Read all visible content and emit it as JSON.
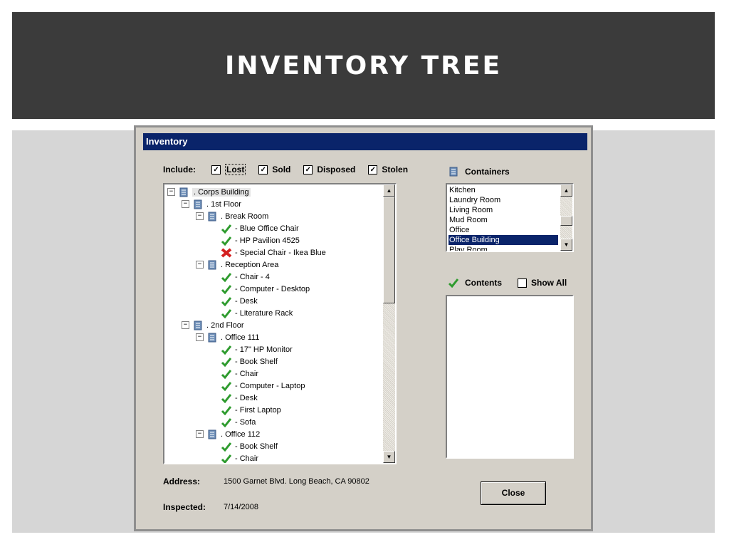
{
  "slide": {
    "title": "INVENTORY TREE"
  },
  "dialog": {
    "title": "Inventory",
    "include": {
      "label": "Include:",
      "options": [
        {
          "label": "Lost",
          "checked": true
        },
        {
          "label": "Sold",
          "checked": true
        },
        {
          "label": "Disposed",
          "checked": true
        },
        {
          "label": "Stolen",
          "checked": true
        }
      ]
    },
    "tree": {
      "nodes": [
        {
          "label": ". Corps Building",
          "level": 0,
          "type": "container",
          "expanded": true,
          "selected": true
        },
        {
          "label": ". 1st Floor",
          "level": 1,
          "type": "container",
          "expanded": true
        },
        {
          "label": ". Break Room",
          "level": 2,
          "type": "container",
          "expanded": true
        },
        {
          "label": "- Blue Office Chair",
          "level": 3,
          "type": "ok"
        },
        {
          "label": "- HP Pavilion 4525",
          "level": 3,
          "type": "ok"
        },
        {
          "label": "- Special Chair - Ikea Blue",
          "level": 3,
          "type": "lost"
        },
        {
          "label": ". Reception Area",
          "level": 2,
          "type": "container",
          "expanded": true
        },
        {
          "label": "- Chair - 4",
          "level": 3,
          "type": "ok"
        },
        {
          "label": "- Computer - Desktop",
          "level": 3,
          "type": "ok"
        },
        {
          "label": "- Desk",
          "level": 3,
          "type": "ok"
        },
        {
          "label": "- Literature Rack",
          "level": 3,
          "type": "ok"
        },
        {
          "label": ". 2nd Floor",
          "level": 1,
          "type": "container",
          "expanded": true
        },
        {
          "label": ". Office 111",
          "level": 2,
          "type": "container",
          "expanded": true
        },
        {
          "label": "- 17\" HP Monitor",
          "level": 3,
          "type": "ok"
        },
        {
          "label": "- Book Shelf",
          "level": 3,
          "type": "ok"
        },
        {
          "label": "- Chair",
          "level": 3,
          "type": "ok"
        },
        {
          "label": "- Computer - Laptop",
          "level": 3,
          "type": "ok"
        },
        {
          "label": "- Desk",
          "level": 3,
          "type": "ok"
        },
        {
          "label": "- First Laptop",
          "level": 3,
          "type": "ok"
        },
        {
          "label": "- Sofa",
          "level": 3,
          "type": "ok"
        },
        {
          "label": ". Office 112",
          "level": 2,
          "type": "container",
          "expanded": true
        },
        {
          "label": "- Book Shelf",
          "level": 3,
          "type": "ok"
        },
        {
          "label": "- Chair",
          "level": 3,
          "type": "ok"
        }
      ]
    },
    "containers": {
      "label": "Containers",
      "items": [
        "Kitchen",
        "Laundry Room",
        "Living Room",
        "Mud Room",
        "Office",
        "Office Building",
        "Play Room"
      ],
      "selected": "Office Building"
    },
    "contents": {
      "label": "Contents",
      "show_all_label": "Show All",
      "show_all_checked": false
    },
    "address": {
      "label": "Address:",
      "value": "1500 Garnet Blvd. Long Beach, CA 90802"
    },
    "inspected": {
      "label": "Inspected:",
      "value": "7/14/2008"
    },
    "close_button": {
      "label": "Close"
    }
  },
  "colors": {
    "titlebar": "#0a246a",
    "header": "#3b3b3b",
    "ok_icon": "#2e9b2e",
    "lost_icon": "#d42020",
    "container_icon": "#6e8fb8"
  }
}
